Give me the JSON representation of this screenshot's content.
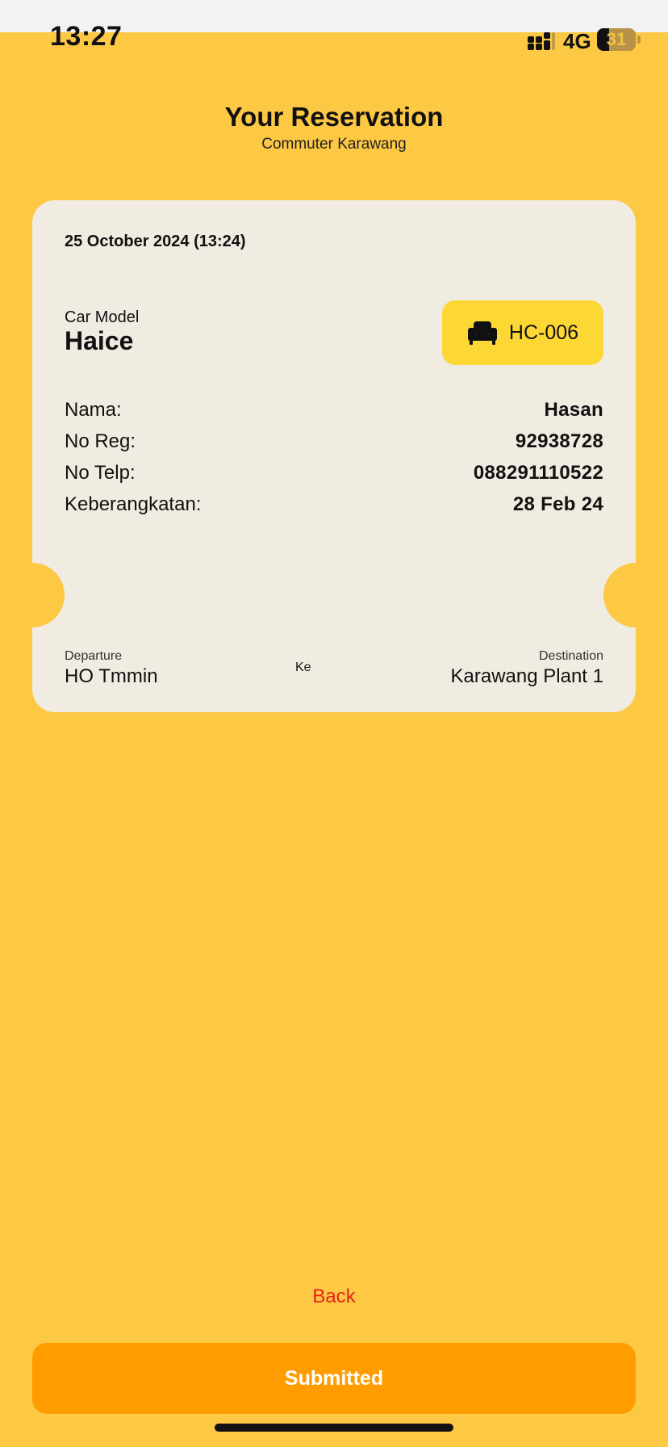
{
  "status_bar": {
    "time": "13:27",
    "network": "4G",
    "battery_level": 31,
    "battery_text": "31"
  },
  "header": {
    "title": "Your Reservation",
    "subtitle": "Commuter Karawang"
  },
  "ticket": {
    "date": "25 October 2024 (13:24)",
    "car_model_label": "Car Model",
    "car_model_value": "Haice",
    "seat_code": "HC-006",
    "rows": [
      {
        "label": "Nama:",
        "value": "Hasan"
      },
      {
        "label": "No Reg:",
        "value": "92938728"
      },
      {
        "label": "No Telp:",
        "value": "088291110522"
      },
      {
        "label": "Keberangkatan:",
        "value": "28 Feb 24"
      }
    ],
    "departure_label": "Departure",
    "departure_value": "HO Tmmin",
    "connector": "Ke",
    "destination_label": "Destination",
    "destination_value": "Karawang Plant 1"
  },
  "actions": {
    "back_label": "Back",
    "submit_label": "Submitted"
  },
  "icons": {
    "seat": "armchair-icon",
    "signal": "signal-icon",
    "battery": "battery-icon"
  },
  "colors": {
    "background": "#FDC843",
    "card": "#F0ECE2",
    "seat_badge": "#FDD835",
    "primary_button": "#FF9D00",
    "back_link": "#E4231B"
  }
}
